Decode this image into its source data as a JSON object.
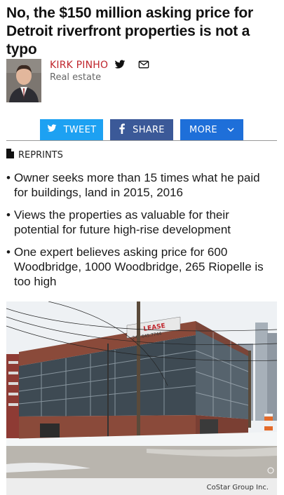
{
  "article": {
    "headline": "No, the $150 million asking price for Detroit riverfront properties is not a typo"
  },
  "byline": {
    "author": "KIRK PINHO",
    "section": "Real estate",
    "icons": [
      "twitter-icon",
      "email-icon"
    ]
  },
  "share": {
    "tweet_label": "TWEET",
    "share_label": "SHARE",
    "more_label": "MORE",
    "colors": {
      "tweet": "#1da1f2",
      "share": "#3b5998",
      "more": "#1e6fd9"
    }
  },
  "reprints": {
    "label": "REPRINTS"
  },
  "bullets": [
    "Owner seeks more than 15 times what he paid for buildings, land in 2015, 2016",
    "Views the properties as valuable for their potential for future high-rise development",
    "One expert believes asking price for 600 Woodbridge, 1000 Woodbridge, 265 Riopelle is too high"
  ],
  "photo": {
    "sign_text": "LEASE",
    "phone_text": "248.645.7744",
    "credit": "CoStar Group Inc."
  },
  "colors": {
    "headline": "#111111",
    "author": "#c0262d",
    "rule": "#9a9a9a"
  }
}
